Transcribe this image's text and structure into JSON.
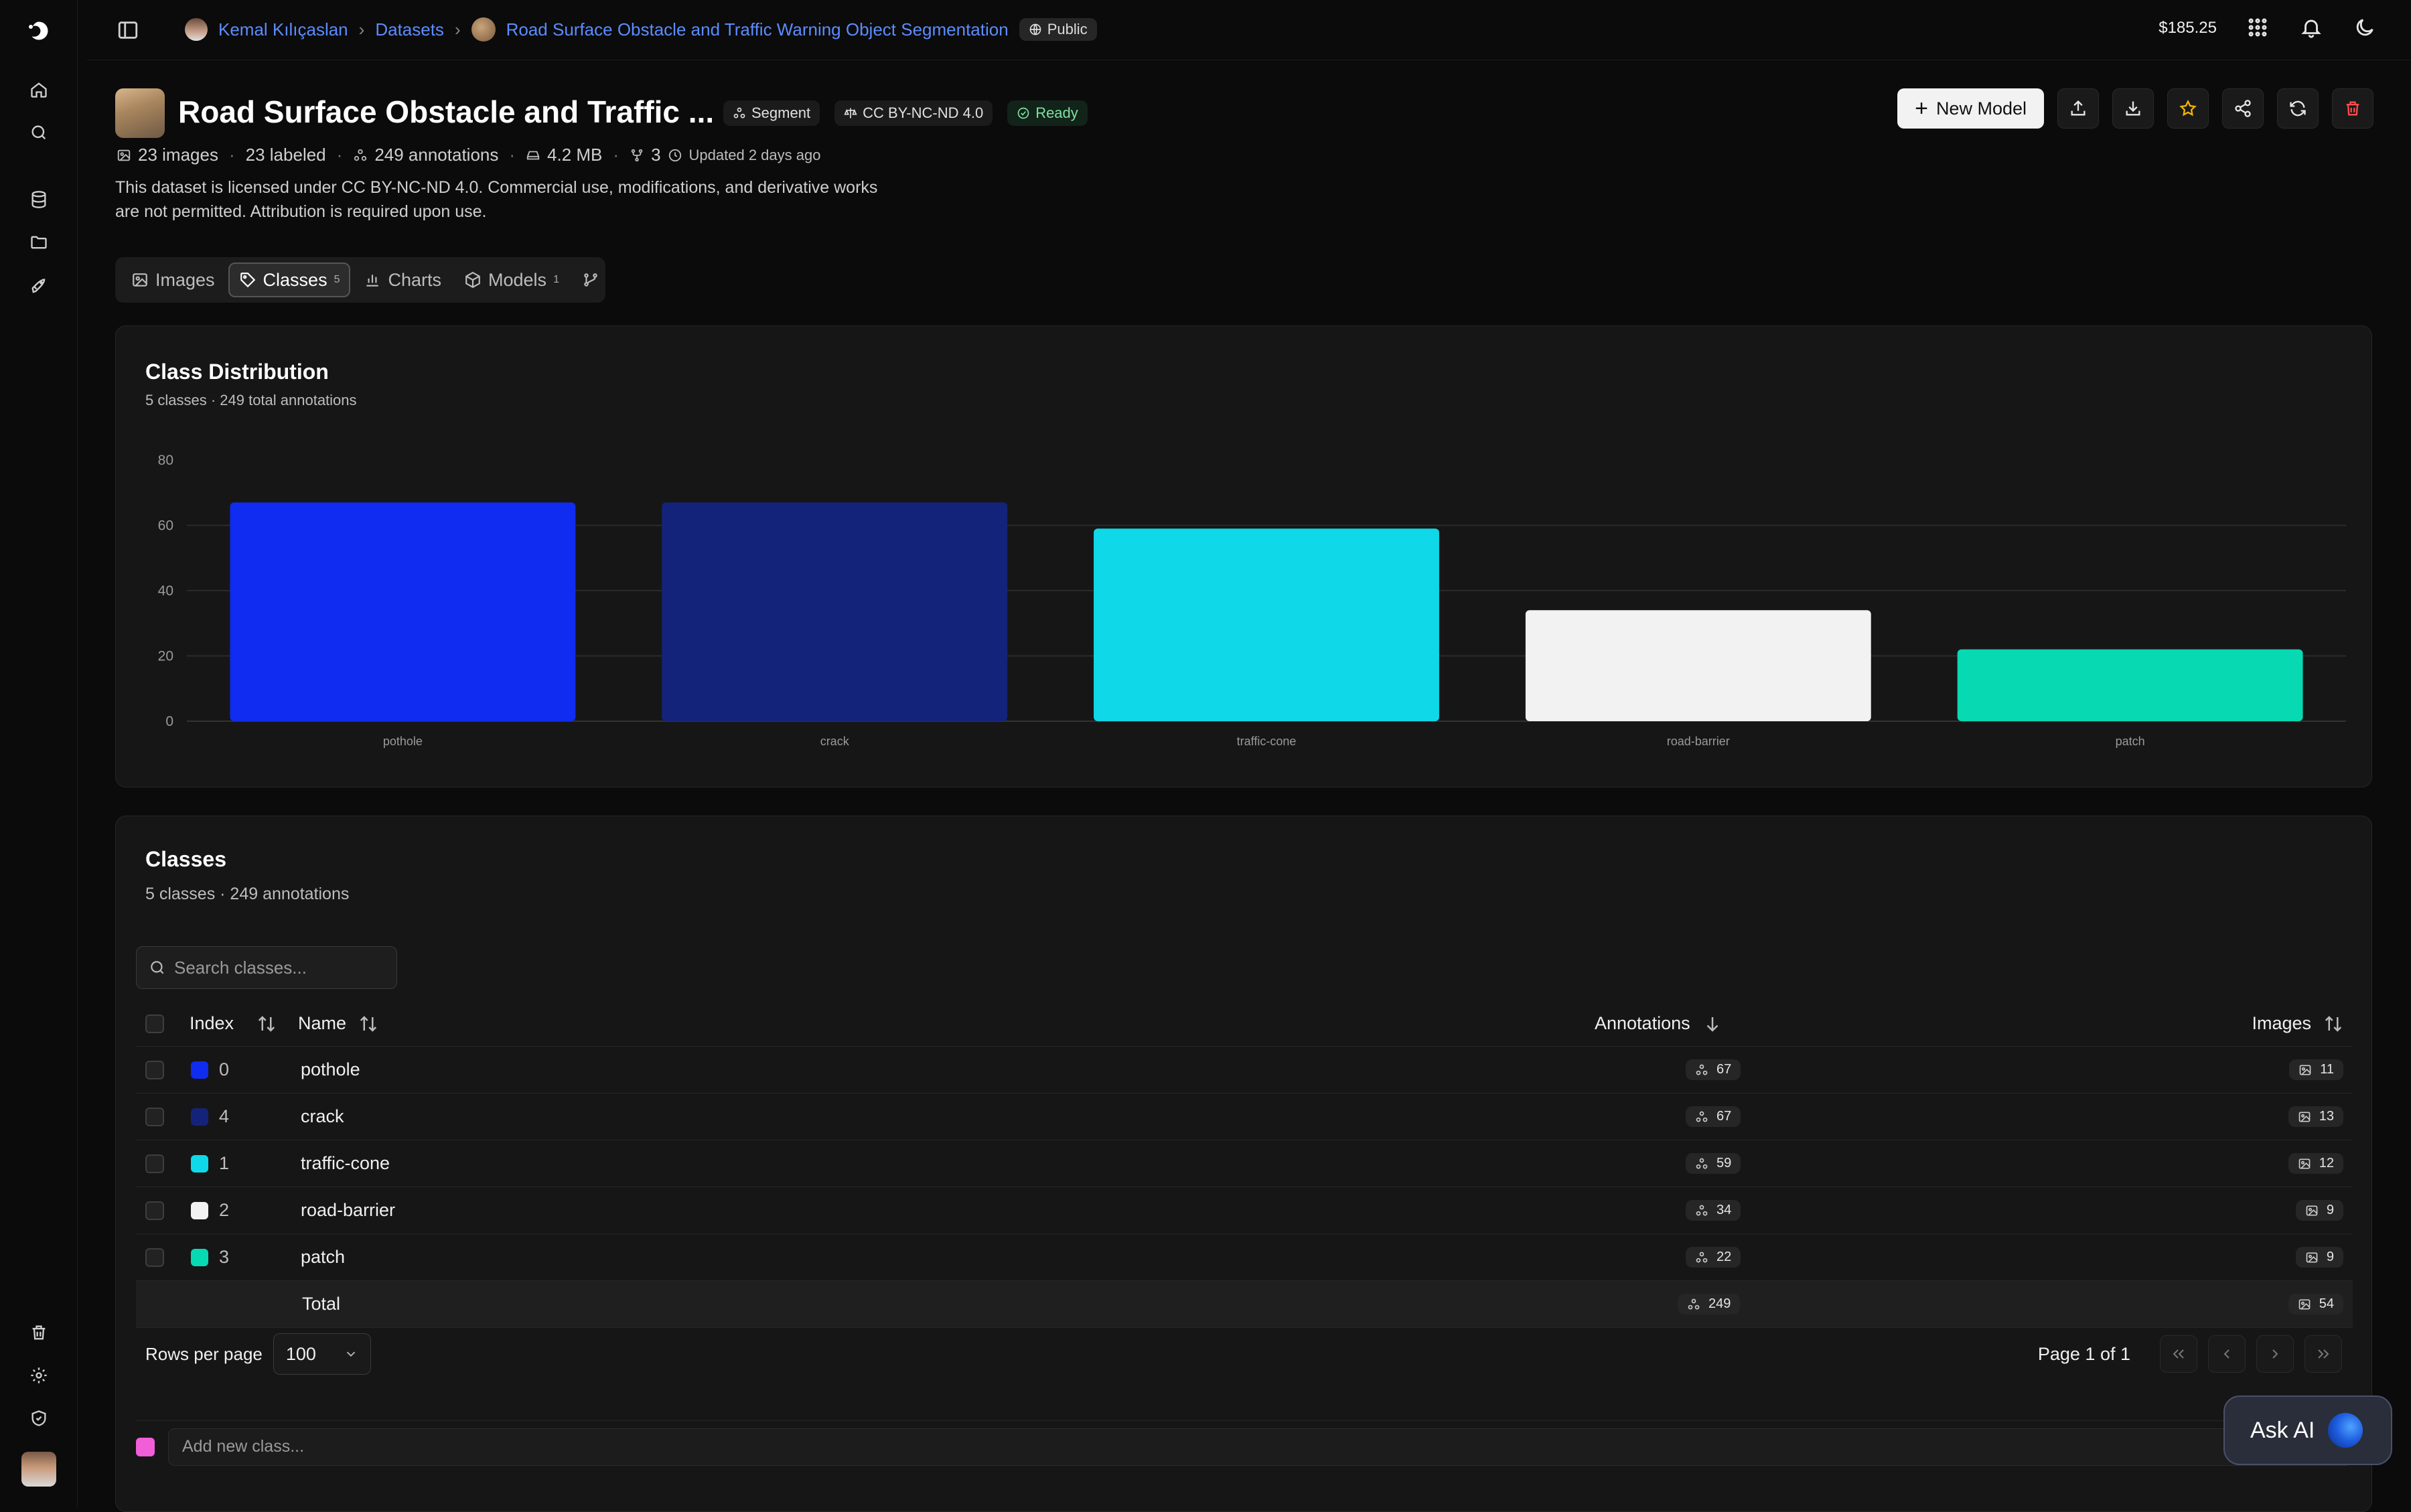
{
  "breadcrumb": {
    "user": "Kemal Kılıçaslan",
    "datasets": "Datasets",
    "dataset": "Road Surface Obstacle and Traffic Warning Object Segmentation",
    "visibility": "Public"
  },
  "topbar": {
    "credit": "$185.25"
  },
  "header": {
    "title": "Road Surface Obstacle and Traffic ...",
    "badges": {
      "task": "Segment",
      "license": "CC BY-NC-ND 4.0",
      "status": "Ready"
    },
    "meta": {
      "images": "23 images",
      "labeled": "23 labeled",
      "annotations": "249 annotations",
      "size": "4.2 MB",
      "forks": "3",
      "updated": "Updated 2 days ago"
    },
    "description": "This dataset is licensed under CC BY-NC-ND 4.0. Commercial use, modifications, and derivative works are not permitted. Attribution is required upon use.",
    "new_model_label": "New Model"
  },
  "tabs": [
    {
      "label": "Images",
      "count": ""
    },
    {
      "label": "Classes",
      "count": "5"
    },
    {
      "label": "Charts",
      "count": ""
    },
    {
      "label": "Models",
      "count": "1"
    }
  ],
  "distribution": {
    "title": "Class Distribution",
    "subtitle": "5 classes · 249 total annotations"
  },
  "chart_data": {
    "type": "bar",
    "title": "Class Distribution",
    "categories": [
      "pothole",
      "crack",
      "traffic-cone",
      "road-barrier",
      "patch"
    ],
    "values": [
      67,
      67,
      59,
      34,
      22
    ],
    "colors": [
      "#0f2cf0",
      "#14237a",
      "#0fd8e8",
      "#f2f2f2",
      "#07d9b3"
    ],
    "yticks": [
      0,
      20,
      40,
      60,
      80
    ],
    "ylim": [
      0,
      80
    ],
    "grid": true
  },
  "classes": {
    "title": "Classes",
    "subtitle": "5 classes · 249 annotations",
    "search_placeholder": "Search classes...",
    "columns": {
      "index": "Index",
      "name": "Name",
      "annotations": "Annotations",
      "images": "Images"
    },
    "rows": [
      {
        "index": "0",
        "name": "pothole",
        "color": "#0f2cf0",
        "annotations": "67",
        "images": "11"
      },
      {
        "index": "4",
        "name": "crack",
        "color": "#14237a",
        "annotations": "67",
        "images": "13"
      },
      {
        "index": "1",
        "name": "traffic-cone",
        "color": "#0fd8e8",
        "annotations": "59",
        "images": "12"
      },
      {
        "index": "2",
        "name": "road-barrier",
        "color": "#f2f2f2",
        "annotations": "34",
        "images": "9"
      },
      {
        "index": "3",
        "name": "patch",
        "color": "#07d9b3",
        "annotations": "22",
        "images": "9"
      }
    ],
    "total": {
      "label": "Total",
      "annotations": "249",
      "images": "54"
    },
    "rows_per_page_label": "Rows per page",
    "rows_per_page": "100",
    "page_info": "Page 1 of 1",
    "add_placeholder": "Add new class..."
  },
  "ask_ai": "Ask AI"
}
